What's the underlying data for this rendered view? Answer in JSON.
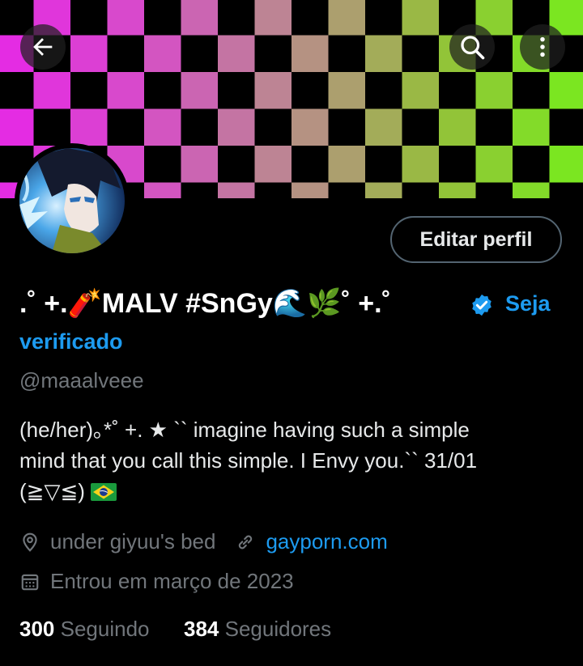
{
  "header": {
    "back_icon": "arrow-left-icon",
    "search_icon": "search-icon",
    "more_icon": "more-vertical-icon"
  },
  "profile": {
    "edit_button": "Editar perfil",
    "display_name": ".˚ +.🧨MALV #SnGy🌊🌿˚ +.˚",
    "verify_link_part1": "Seja",
    "verify_link_part2": "verificado",
    "handle": "@maaalveee",
    "bio_lines": [
      "(he/her)｡*˚ +.   ★   `` imagine having such a simple",
      "mind that you call this simple. I Envy you.``    31/01",
      "(≧▽≦)"
    ],
    "location": "under giyuu's bed",
    "website": "gayporn.com",
    "joined": "Entrou em março de 2023",
    "following_count": "300",
    "following_label": "Seguindo",
    "followers_count": "384",
    "followers_label": "Seguidores"
  },
  "colors": {
    "background": "#000000",
    "accent": "#1d9bf0",
    "muted": "#71767b",
    "text": "#e7e9ea"
  }
}
